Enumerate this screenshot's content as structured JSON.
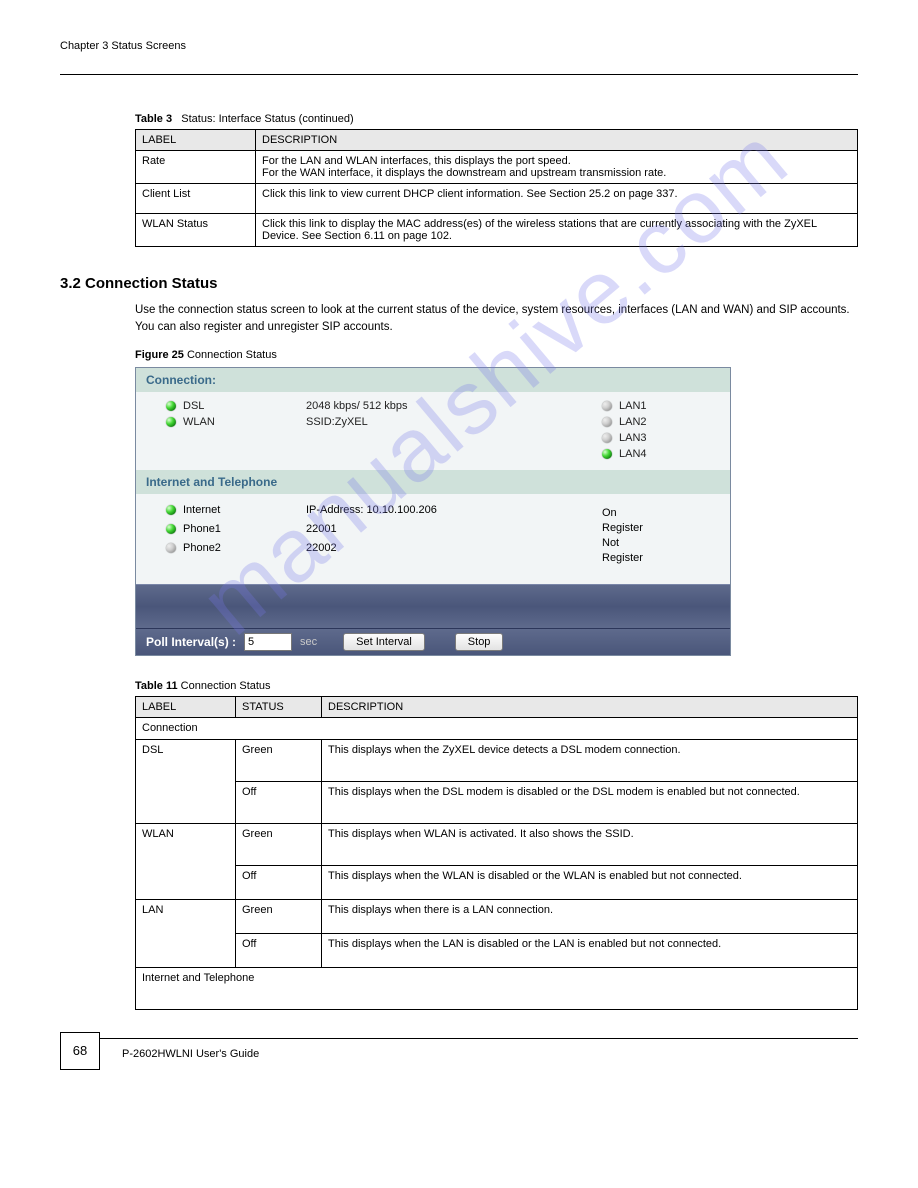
{
  "page": {
    "chapter": "Chapter 3 Status Screens",
    "page_number": "68",
    "footer_text": "P-2602HWLNI User's Guide"
  },
  "table3": {
    "caption": "Table 3   Status: Interface Status (continued)",
    "headers": [
      "LABEL",
      "DESCRIPTION"
    ],
    "rows": [
      {
        "label": "Rate",
        "desc": "For the LAN and WLAN interfaces, this displays the port speed.\nFor the WAN interface, it displays the downstream and upstream transmission rate."
      },
      {
        "label": "Client List",
        "desc": "Click this link to view current DHCP client information. See Section 25.2 on page 337."
      },
      {
        "label": "WLAN Status",
        "desc": "Click this link to display the MAC address(es) of the wireless stations that are currently associating with the ZyXEL Device. See Section 6.11 on page 102."
      }
    ]
  },
  "section2": {
    "heading": "3.2  Connection Status",
    "text": "Use the connection status screen to look at the current status of the device, system resources, interfaces (LAN and WAN) and SIP accounts. You can also register and unregister SIP accounts.",
    "fig_caption_label": "Figure 25   ",
    "fig_caption_text": "Connection Status"
  },
  "figure": {
    "sec1": "Connection:",
    "dsl": "DSL",
    "wlan": "WLAN",
    "rate": "2048 kbps/ 512 kbps",
    "ssid": "SSID:ZyXEL",
    "lan1": "LAN1",
    "lan2": "LAN2",
    "lan3": "LAN3",
    "lan4": "LAN4",
    "sec2": "Internet and Telephone",
    "internet": "Internet",
    "phone1": "Phone1",
    "phone2": "Phone2",
    "ip": "IP-Address: 10.10.100.206",
    "pn1": "22001",
    "pn2": "22002",
    "status1a": "On",
    "status1b": "Register",
    "status2a": "Not",
    "status2b": "Register",
    "poll_label": "Poll Interval(s) :",
    "poll_value": "5",
    "poll_unit": "sec",
    "btn_set": "Set Interval",
    "btn_stop": "Stop"
  },
  "table11": {
    "caption_prefix": "Table 11   ",
    "caption_text": "Connection Status",
    "headers": [
      "LABEL",
      "STATUS",
      "DESCRIPTION"
    ],
    "rows": [
      {
        "c1": "Connection",
        "c2": "",
        "c3": "",
        "big": false
      },
      {
        "c1": "DSL",
        "c2": "Green",
        "c3": "This displays when the ZyXEL device detects a DSL modem connection.",
        "big": true
      },
      {
        "c1": "",
        "c2": "Off",
        "c3": "This displays when the DSL modem is disabled or the DSL modem is enabled but not connected.",
        "big": true
      },
      {
        "c1": "WLAN",
        "c2": "Green",
        "c3": "This displays when WLAN is activated. It also shows the SSID.",
        "big": true
      },
      {
        "c1": "",
        "c2": "Off",
        "c3": "This displays when the WLAN is disabled or the WLAN is enabled but not connected.",
        "big": false
      },
      {
        "c1": "LAN",
        "c2": "Green",
        "c3": "This displays when there is a LAN connection.",
        "big": false
      },
      {
        "c1": "",
        "c2": "Off",
        "c3": "This displays when the LAN is disabled or the LAN is enabled but not connected.",
        "big": false
      },
      {
        "c1": "Internet and Telephone",
        "c2": "",
        "c3": "",
        "big": true
      }
    ]
  },
  "watermark": "manualshive.com"
}
